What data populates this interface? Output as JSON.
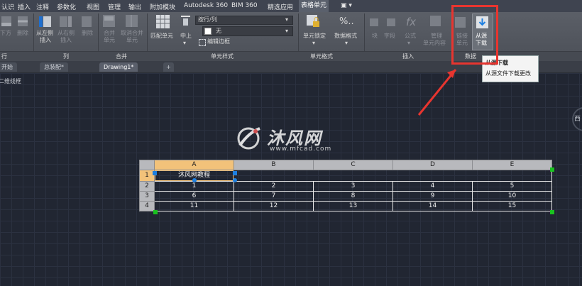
{
  "menubar": {
    "items": [
      "认识",
      "插入",
      "注释",
      "参数化",
      "视图",
      "管理",
      "输出",
      "附加模块",
      "Autodesk 360",
      "BIM 360",
      "精选应用",
      "表格单元"
    ],
    "extra": "▣ ▾"
  },
  "ribbon": {
    "rows_left": [
      "下方",
      "删除",
      "行"
    ],
    "cols": [
      "从左侧",
      "从右侧",
      "删除",
      "插入",
      "插入",
      "列"
    ],
    "merge": [
      "合并",
      "单元",
      "取消合并",
      "单元"
    ],
    "match_cell": "匹配单元",
    "align": "中上",
    "row_col_select": "按行/列",
    "fill_select": "无",
    "edit_border": "编辑边框",
    "cell_lock": "单元锁定",
    "data_format": "数据格式",
    "insert_items": [
      "块",
      "字段",
      "公式",
      "管理",
      "单元内容"
    ],
    "link_cell": [
      "链接",
      "单元"
    ],
    "download_source": [
      "从源",
      "下载"
    ],
    "panel_labels": {
      "rows": "行",
      "cols": "列",
      "merge": "合并",
      "cell_style": "单元样式",
      "cell_format": "单元格式",
      "insert": "插入",
      "data": "数据"
    }
  },
  "tooltip": {
    "title": "从源下载",
    "desc": "从源文件下载更改"
  },
  "doc_tabs": [
    "开始",
    "总装配*",
    "Drawing1*",
    "+"
  ],
  "viewport_label": "二维线框",
  "watermark": {
    "cn": "沐风网",
    "url": "www.mfcad.com"
  },
  "compass": "西",
  "table": {
    "col_headers": [
      "A",
      "B",
      "C",
      "D",
      "E"
    ],
    "row_headers": [
      "1",
      "2",
      "3",
      "4"
    ],
    "title_cell": "沐风网教程",
    "rows": [
      [
        "1",
        "2",
        "3",
        "4",
        "5"
      ],
      [
        "6",
        "7",
        "8",
        "9",
        "10"
      ],
      [
        "11",
        "12",
        "13",
        "14",
        "15"
      ]
    ]
  },
  "colors": {
    "highlight_box": "#e8352f",
    "active_header": "#f2c27a",
    "grip": "#1d7fe0",
    "corner_grip": "#19c21f"
  }
}
